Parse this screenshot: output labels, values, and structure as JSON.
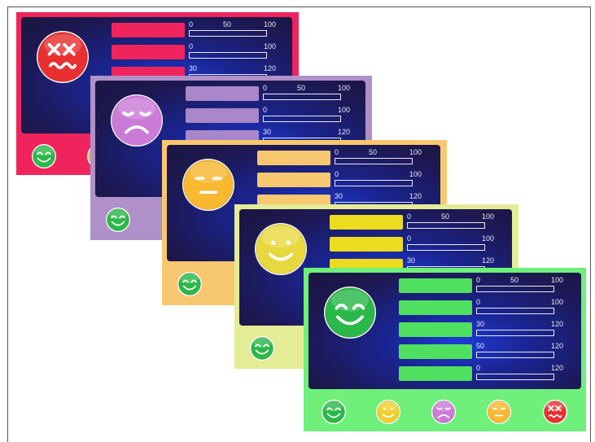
{
  "cards": [
    {
      "id": "sad-x",
      "bg": "#f0245c",
      "bar_color": "#f0245c",
      "face": "dizzy-face-icon",
      "face_color": "#e83030",
      "scales": [
        [
          "0",
          "50",
          "100"
        ],
        [
          "0",
          "",
          "100"
        ],
        [
          "30",
          "",
          "120"
        ]
      ],
      "buttons": [
        {
          "icon": "happy-face-icon",
          "color": "#2bb84a"
        },
        {
          "icon": "smile-face-icon",
          "color": "#f0c430"
        }
      ]
    },
    {
      "id": "sad",
      "bg": "#b090c8",
      "bar_color": "#a987c8",
      "face": "frown-face-icon",
      "face_color": "#cc7ad8",
      "scales": [
        [
          "0",
          "50",
          "100"
        ],
        [
          "0",
          "",
          "100"
        ],
        [
          "30",
          "",
          "120"
        ]
      ],
      "buttons": [
        {
          "icon": "happy-face-icon",
          "color": "#2bb84a"
        }
      ]
    },
    {
      "id": "neutral",
      "bg": "#f8c870",
      "bar_color": "#f8c870",
      "face": "neutral-face-icon",
      "face_color": "#f8b830",
      "scales": [
        [
          "0",
          "50",
          "100"
        ],
        [
          "0",
          "",
          "100"
        ],
        [
          "30",
          "",
          "120"
        ]
      ],
      "buttons": [
        {
          "icon": "happy-face-icon",
          "color": "#2bb84a"
        }
      ]
    },
    {
      "id": "smile",
      "bg": "#e4ec96",
      "bar_color": "#ecdc20",
      "face": "smile-face-icon",
      "face_color": "#e8d840",
      "scales": [
        [
          "0",
          "50",
          "100"
        ],
        [
          "0",
          "",
          "100"
        ],
        [
          "30",
          "",
          "120"
        ]
      ],
      "buttons": [
        {
          "icon": "happy-face-icon",
          "color": "#2bb84a"
        }
      ]
    },
    {
      "id": "happy",
      "bg": "#6ef07a",
      "bar_color": "#50e060",
      "face": "happy-face-icon",
      "face_color": "#2bb84a",
      "scales": [
        [
          "0",
          "50",
          "100"
        ],
        [
          "0",
          "",
          "100"
        ],
        [
          "30",
          "",
          "120"
        ],
        [
          "50",
          "",
          "120"
        ],
        [
          "0",
          "",
          "120"
        ]
      ],
      "buttons": [
        {
          "icon": "happy-face-icon",
          "color": "#2bb84a"
        },
        {
          "icon": "smile-face-icon",
          "color": "#f0d030"
        },
        {
          "icon": "frown-face-icon",
          "color": "#cc7ad8"
        },
        {
          "icon": "neutral-face-icon",
          "color": "#f8b830"
        },
        {
          "icon": "dizzy-face-icon",
          "color": "#e83030"
        }
      ]
    }
  ]
}
